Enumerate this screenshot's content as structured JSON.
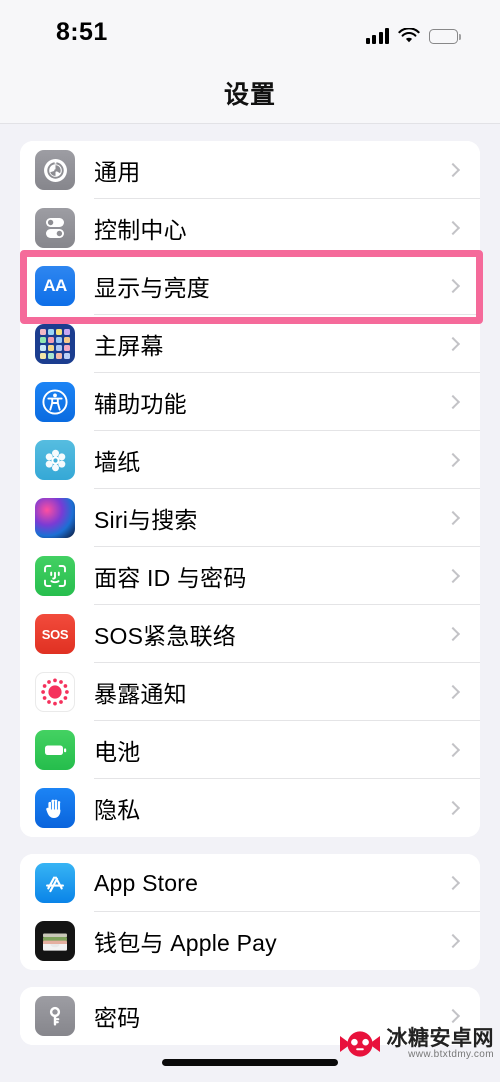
{
  "status_bar": {
    "time": "8:51",
    "signal_icon": "cellular-bars-icon",
    "wifi_icon": "wifi-icon",
    "battery_icon": "battery-full-icon"
  },
  "header": {
    "title": "设置"
  },
  "highlight": {
    "color": "#F56A9A",
    "target_row": "显示与亮度"
  },
  "groups": [
    {
      "rows": [
        {
          "label": "通用",
          "icon": "gear-icon",
          "icon_color": "#8E8E93"
        },
        {
          "label": "控制中心",
          "icon": "control-center-icon",
          "icon_color": "#8E8E93"
        },
        {
          "label": "显示与亮度",
          "icon": "display-brightness-aa-icon",
          "icon_color": "#0A6FE8"
        },
        {
          "label": "主屏幕",
          "icon": "home-screen-icon",
          "icon_color": "#1B3D8F"
        },
        {
          "label": "辅助功能",
          "icon": "accessibility-icon",
          "icon_color": "#0A6BE0"
        },
        {
          "label": "墙纸",
          "icon": "wallpaper-icon",
          "icon_color": "#35A8D6"
        },
        {
          "label": "Siri与搜索",
          "icon": "siri-icon",
          "icon_color": "#7A3BD4"
        },
        {
          "label": "面容 ID 与密码",
          "icon": "face-id-icon",
          "icon_color": "#27BE4E"
        },
        {
          "label": "SOS紧急联络",
          "icon": "emergency-sos-icon",
          "icon_color": "#E03122"
        },
        {
          "label": "暴露通知",
          "icon": "exposure-notification-icon",
          "icon_color": "#F5315C"
        },
        {
          "label": "电池",
          "icon": "battery-icon",
          "icon_color": "#25BD4C"
        },
        {
          "label": "隐私",
          "icon": "privacy-hand-icon",
          "icon_color": "#0A64DC"
        }
      ]
    },
    {
      "rows": [
        {
          "label": "App Store",
          "icon": "app-store-icon",
          "icon_color": "#0A84E8"
        },
        {
          "label": "钱包与 Apple Pay",
          "icon": "wallet-icon",
          "icon_color": "#141414"
        }
      ]
    },
    {
      "rows": [
        {
          "label": "密码",
          "icon": "passwords-key-icon",
          "icon_color": "#8E8E93"
        }
      ]
    }
  ],
  "chevron_icon": "chevron-right-icon",
  "home_indicator": "home-indicator-bar",
  "watermark": {
    "name": "冰糖安卓网",
    "url": "www.btxtdmy.com",
    "logo_icon": "candy-logo-icon"
  }
}
